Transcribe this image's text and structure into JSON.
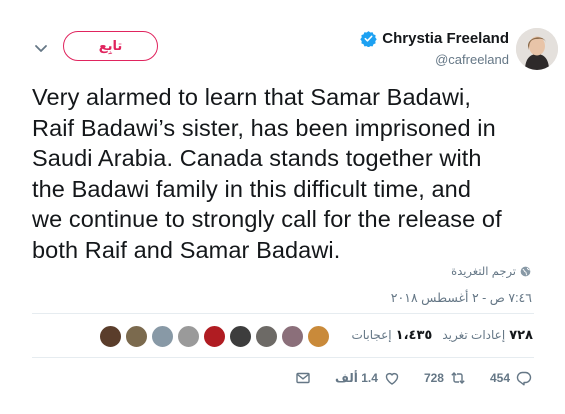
{
  "header": {
    "follow_label": "تابِع",
    "name": "Chrystia Freeland",
    "handle": "@cafreeland",
    "verified": true
  },
  "tweet": {
    "lines": [
      "Very alarmed to learn that Samar Badawi,",
      "Raif Badawi’s sister, has been imprisoned in",
      "Saudi Arabia. Canada stands together with",
      "the Badawi family in this difficult time, and",
      "we continue to strongly call for the release of",
      "both Raif and Samar Badawi."
    ],
    "translate_label": "ترجم التغريدة",
    "timestamp": "٧:٤٦ ص - ٢ أغسطس ٢٠١٨"
  },
  "stats": {
    "retweets_count": "٧٢٨",
    "retweets_label": "إعادات تغريد",
    "likes_count": "١،٤٣٥",
    "likes_label": "إعجابات"
  },
  "liker_faces": [
    {
      "icon": "avatar-dog",
      "color": "#c98a3a"
    },
    {
      "icon": "avatar-kitten",
      "color": "#8b6f7a"
    },
    {
      "icon": "avatar-person",
      "color": "#6d6a66"
    },
    {
      "icon": "avatar-person",
      "color": "#3d3d3d"
    },
    {
      "icon": "avatar-roses",
      "color": "#b01c22"
    },
    {
      "icon": "avatar-person",
      "color": "#9a9a9a"
    },
    {
      "icon": "avatar-default",
      "color": "#8899a6"
    },
    {
      "icon": "avatar-pets",
      "color": "#7b6a4e"
    },
    {
      "icon": "avatar-bird",
      "color": "#5a3d2b"
    }
  ],
  "actions": {
    "reply_count": "454",
    "retweet_count": "728",
    "like_count": "1.4 ألف",
    "colors": {
      "accent": "#e0245e",
      "muted": "#657786"
    }
  }
}
